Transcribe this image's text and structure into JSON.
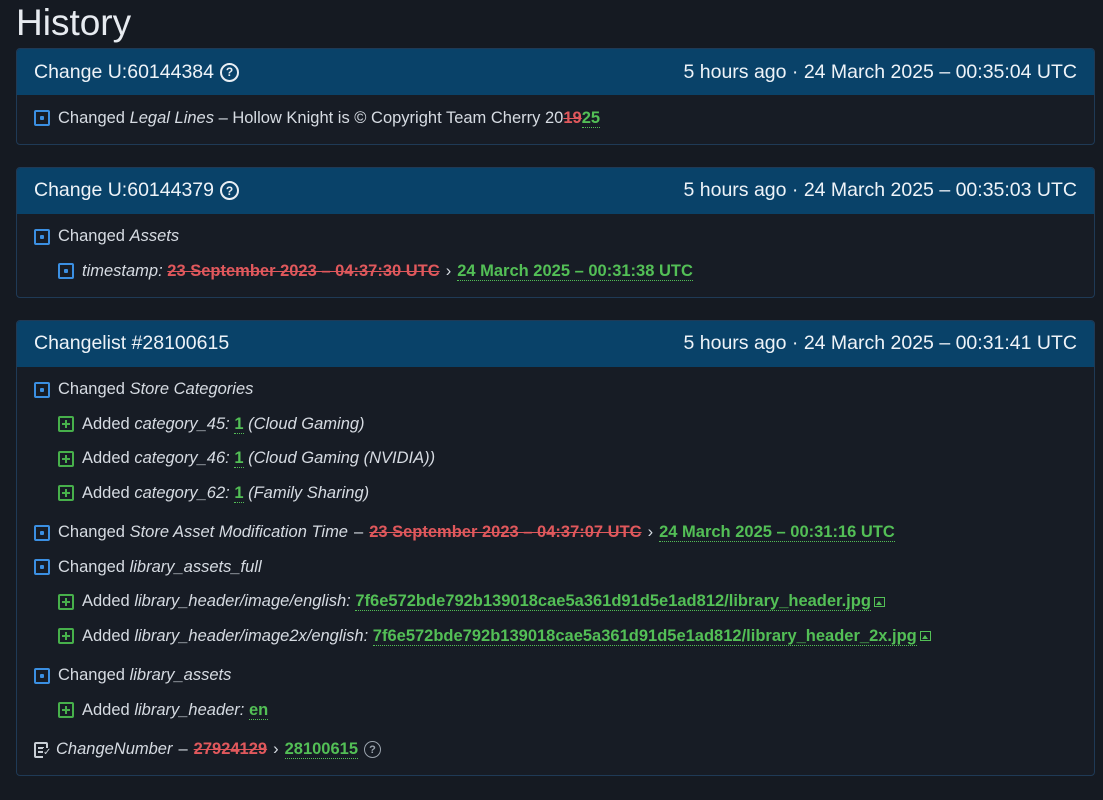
{
  "page_title": "History",
  "cards": [
    {
      "title": "Change U:60144384",
      "time": "5 hours ago · 24 March 2025 – 00:35:04 UTC",
      "rows": [
        {
          "verb": "Changed",
          "key": "Legal Lines",
          "text": " – Hollow Knight is © Copyright Team Cherry 20",
          "old": "19",
          "new": "25"
        }
      ]
    },
    {
      "title": "Change U:60144379",
      "time": "5 hours ago · 24 March 2025 – 00:35:03 UTC",
      "rows": [
        {
          "verb": "Changed",
          "key": "Assets"
        },
        {
          "key": "timestamp:",
          "old": "23 September 2023 – 04:37:30 UTC",
          "arrow": "›",
          "new": "24 March 2025 – 00:31:38 UTC"
        }
      ]
    },
    {
      "title": "Changelist #28100615",
      "time": "5 hours ago · 24 March 2025 – 00:31:41 UTC",
      "rows": [
        {
          "verb": "Changed",
          "key": "Store Categories"
        },
        {
          "verb": "Added",
          "key": "category_45:",
          "new": "1",
          "note": "(Cloud Gaming)"
        },
        {
          "verb": "Added",
          "key": "category_46:",
          "new": "1",
          "note": "(Cloud Gaming (NVIDIA))"
        },
        {
          "verb": "Added",
          "key": "category_62:",
          "new": "1",
          "note": "(Family Sharing)"
        },
        {
          "verb": "Changed",
          "key": "Store Asset Modification Time",
          "dash": "–",
          "old": "23 September 2023 – 04:37:07 UTC",
          "arrow": "›",
          "new": "24 March 2025 – 00:31:16 UTC"
        },
        {
          "verb": "Changed",
          "key": "library_assets_full"
        },
        {
          "verb": "Added",
          "key": "library_header/image/english:",
          "new": "7f6e572bde792b139018cae5a361d91d5e1ad812/library_header.jpg"
        },
        {
          "verb": "Added",
          "key": "library_header/image2x/english:",
          "new": "7f6e572bde792b139018cae5a361d91d5e1ad812/library_header_2x.jpg"
        },
        {
          "verb": "Changed",
          "key": "library_assets"
        },
        {
          "verb": "Added",
          "key": "library_header:",
          "new": "en"
        },
        {
          "key": "ChangeNumber",
          "dash": "–",
          "old": "27924129",
          "arrow": "›",
          "new": "28100615"
        }
      ]
    }
  ],
  "icons": {
    "changed": "changed-square-icon",
    "added": "added-plus-icon",
    "changenumber": "document-icon",
    "help": "help-circle-icon",
    "image": "image-icon"
  },
  "colors": {
    "header_bg": "#094269",
    "old_value": "#e0585c",
    "new_value": "#53bf56",
    "changed_icon": "#3b8fe2"
  }
}
